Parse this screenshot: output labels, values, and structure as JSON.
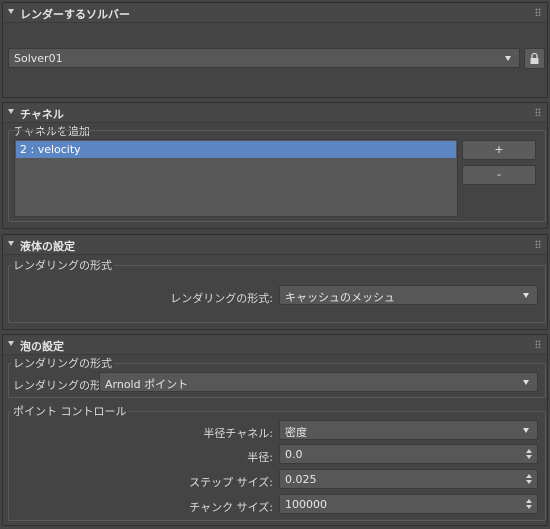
{
  "solver_rollout": {
    "title": "レンダーするソルバー",
    "solver_value": "Solver01"
  },
  "channel_rollout": {
    "title": "チャネル",
    "add_label": "チャネルを追加",
    "items": [
      {
        "label": "2 : velocity",
        "selected": true
      }
    ],
    "add_button": "+",
    "remove_button": "-"
  },
  "liquid_rollout": {
    "title": "液体の設定",
    "group_label": "レンダリングの形式",
    "render_type_label": "レンダリングの形式:",
    "render_type_value": "キャッシュのメッシュ"
  },
  "foam_rollout": {
    "title": "泡の設定",
    "render_group_label": "レンダリングの形式",
    "render_type_label": "レンダリングの形式:",
    "render_type_value": "Arnold ポイント",
    "point_group_label": "ポイント コントロール",
    "radius_channel_label": "半径チャネル:",
    "radius_channel_value": "密度",
    "radius_label": "半径:",
    "radius_value": "0.0",
    "step_size_label": "ステップ サイズ:",
    "step_size_value": "0.025",
    "chunk_size_label": "チャンク サイズ:",
    "chunk_size_value": "100000"
  },
  "colors": {
    "background": "#444444",
    "field": "#575757",
    "selection": "#5b86c3"
  }
}
